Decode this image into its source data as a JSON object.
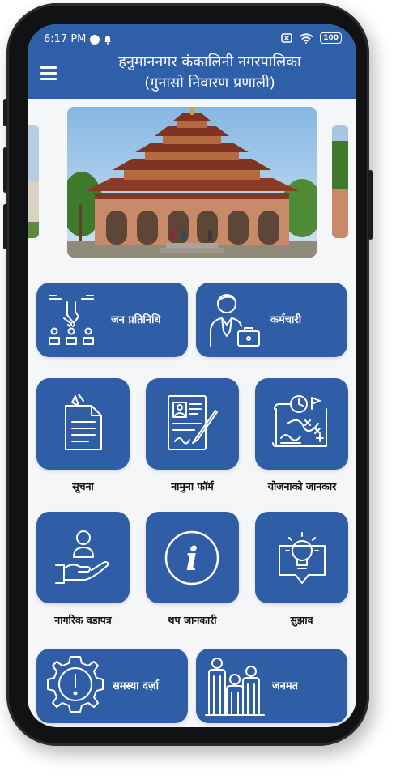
{
  "status_bar": {
    "time": "6:17 PM",
    "battery": "100"
  },
  "header": {
    "title_line1": "हनुमाननगर कंकालिनी नगरपालिका",
    "title_line2": "(गुनासो निवारण प्रणाली)"
  },
  "menu": {
    "wide_tiles": [
      {
        "label": "जन प्रतिनिधि",
        "icon": "representatives-icon"
      },
      {
        "label": "कर्मचारी",
        "icon": "employee-icon"
      }
    ],
    "grid_row1": [
      {
        "label": "सूचना",
        "icon": "notice-document-icon"
      },
      {
        "label": "नामुना फॉर्म",
        "icon": "sample-form-icon"
      },
      {
        "label": "योजनाको जानकार",
        "icon": "plan-strategy-icon"
      }
    ],
    "grid_row2": [
      {
        "label": "नागरिक वडापत्र",
        "icon": "citizen-charter-icon"
      },
      {
        "label": "थप जानकारी",
        "icon": "info-icon"
      },
      {
        "label": "सुझाव",
        "icon": "suggestion-bulb-icon"
      }
    ],
    "bottom_tiles": [
      {
        "label": "समस्या दर्ज़ा",
        "icon": "problem-gear-icon"
      },
      {
        "label": "जनमत",
        "icon": "opinion-people-icon"
      }
    ]
  },
  "colors": {
    "primary": "#2e5fa8",
    "tile": "#2f5ea7",
    "background": "#f5f6f8"
  }
}
